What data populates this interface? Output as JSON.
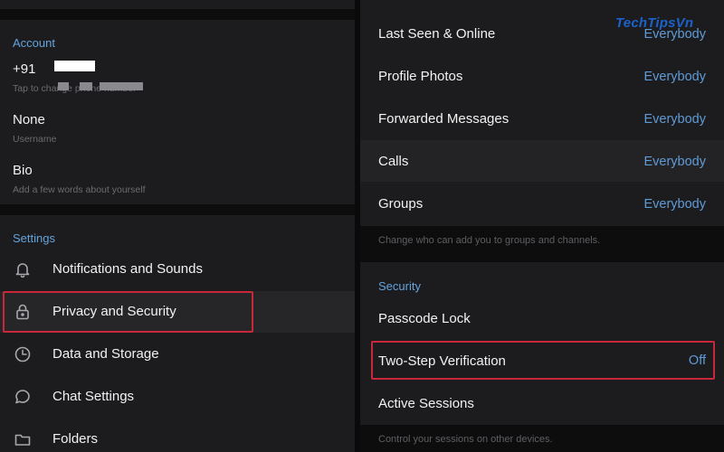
{
  "account": {
    "section_title": "Account",
    "phone_prefix": "+91",
    "phone_hint": "Tap to change phone number",
    "username_value": "None",
    "username_hint": "Username",
    "bio_title": "Bio",
    "bio_hint": "Add a few words about yourself"
  },
  "settings": {
    "section_title": "Settings",
    "items": [
      {
        "label": "Notifications and Sounds",
        "icon": "bell-icon"
      },
      {
        "label": "Privacy and Security",
        "icon": "lock-icon",
        "highlighted": true
      },
      {
        "label": "Data and Storage",
        "icon": "clock-icon"
      },
      {
        "label": "Chat Settings",
        "icon": "chat-bubble-icon"
      },
      {
        "label": "Folders",
        "icon": "folder-icon"
      }
    ]
  },
  "privacy": {
    "items": [
      {
        "label": "Last Seen & Online",
        "value": "Everybody"
      },
      {
        "label": "Profile Photos",
        "value": "Everybody"
      },
      {
        "label": "Forwarded Messages",
        "value": "Everybody"
      },
      {
        "label": "Calls",
        "value": "Everybody"
      },
      {
        "label": "Groups",
        "value": "Everybody"
      }
    ],
    "groups_hint": "Change who can add you to groups and channels."
  },
  "security": {
    "section_title": "Security",
    "passcode_label": "Passcode Lock",
    "two_step_label": "Two-Step Verification",
    "two_step_value": "Off",
    "sessions_label": "Active Sessions",
    "sessions_hint": "Control your sessions on other devices."
  },
  "watermark": "TechTipsVn",
  "colors": {
    "panel_bg": "#1c1c1e",
    "accent_blue": "#64a4dd",
    "highlight_red": "#c8283a",
    "watermark_blue": "#1b62c9"
  }
}
